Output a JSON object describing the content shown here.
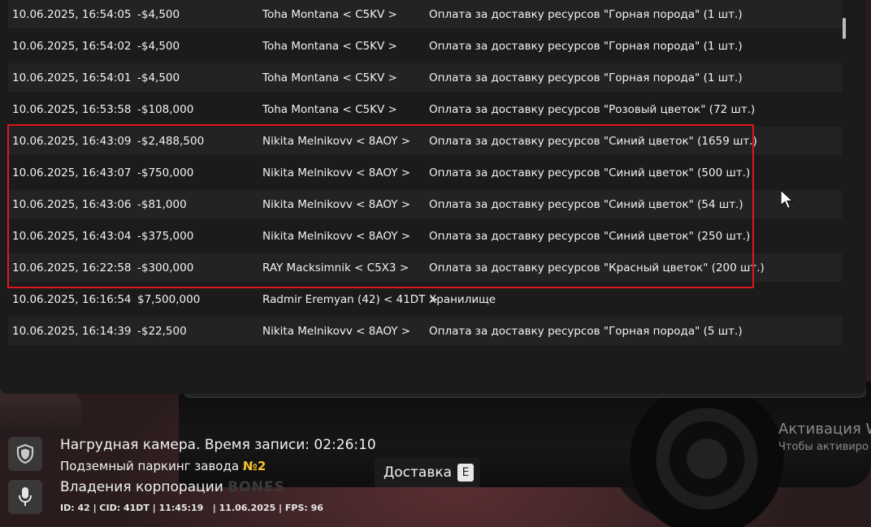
{
  "transactions": [
    {
      "date": "10.06.2025, 16:54:05",
      "amount": "-$4,500",
      "user": "Toha Montana < C5KV >",
      "desc": "Оплата за доставку ресурсов \"Горная порода\" (1 шт.)"
    },
    {
      "date": "10.06.2025, 16:54:02",
      "amount": "-$4,500",
      "user": "Toha Montana < C5KV >",
      "desc": "Оплата за доставку ресурсов \"Горная порода\" (1 шт.)"
    },
    {
      "date": "10.06.2025, 16:54:01",
      "amount": "-$4,500",
      "user": "Toha Montana < C5KV >",
      "desc": "Оплата за доставку ресурсов \"Горная порода\" (1 шт.)"
    },
    {
      "date": "10.06.2025, 16:53:58",
      "amount": "-$108,000",
      "user": "Toha Montana < C5KV >",
      "desc": "Оплата за доставку ресурсов \"Розовый цветок\" (72 шт.)"
    },
    {
      "date": "10.06.2025, 16:43:09",
      "amount": "-$2,488,500",
      "user": "Nikita Melnikovv < 8AOY >",
      "desc": "Оплата за доставку ресурсов \"Синий цветок\" (1659 шт.)"
    },
    {
      "date": "10.06.2025, 16:43:07",
      "amount": "-$750,000",
      "user": "Nikita Melnikovv < 8AOY >",
      "desc": "Оплата за доставку ресурсов \"Синий цветок\" (500 шт.)"
    },
    {
      "date": "10.06.2025, 16:43:06",
      "amount": "-$81,000",
      "user": "Nikita Melnikovv < 8AOY >",
      "desc": "Оплата за доставку ресурсов \"Синий цветок\" (54 шт.)"
    },
    {
      "date": "10.06.2025, 16:43:04",
      "amount": "-$375,000",
      "user": "Nikita Melnikovv < 8AOY >",
      "desc": "Оплата за доставку ресурсов \"Синий цветок\" (250 шт.)"
    },
    {
      "date": "10.06.2025, 16:22:58",
      "amount": "-$300,000",
      "user": "RAY Macksimnik < C5X3 >",
      "desc": "Оплата за доставку ресурсов \"Красный цветок\" (200 шт.)"
    },
    {
      "date": "10.06.2025, 16:16:54",
      "amount": "$7,500,000",
      "user": "Radmir Eremyan (42) < 41DT >",
      "desc": "Хранилище"
    },
    {
      "date": "10.06.2025, 16:14:39",
      "amount": "-$22,500",
      "user": "Nikita Melnikovv < 8AOY >",
      "desc": "Оплата за доставку ресурсов \"Горная порода\" (5 шт.)"
    }
  ],
  "hud": {
    "camera": "Нагрудная камера. Время записи: 02:26:10",
    "parking_prefix": "Подземный паркинг завода ",
    "parking_num": "№2",
    "corp_prefix": "Владения корпорации ",
    "corp_brand": "BONES",
    "info": "ID: 42 | CID: 41DT | 11:45:19   | 11.06.2025 | FPS: 96"
  },
  "delivery": {
    "label": "Доставка",
    "key": "E"
  },
  "activation": {
    "title": "Активация W",
    "subtitle": "Чтобы активиро"
  },
  "icons": {
    "shield": "shield-icon",
    "mic": "microphone-icon",
    "cursor": "mouse-cursor-icon"
  },
  "colors": {
    "highlight": "#e0161c",
    "accent_yellow": "#f4c22b"
  }
}
